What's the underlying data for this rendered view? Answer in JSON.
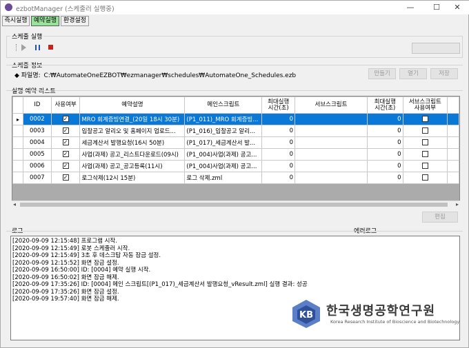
{
  "window": {
    "title": "ezbotManager (스케줄러 실행중)",
    "controls": {
      "minimize": "—",
      "maximize": "☐",
      "close": "✕"
    }
  },
  "tabs": [
    {
      "label": "즉시실행",
      "active": false
    },
    {
      "label": "예약실행",
      "active": true
    },
    {
      "label": "환경설정",
      "active": false
    }
  ],
  "scheduler_run": {
    "label": "스케줄 실행",
    "controls": [
      "play",
      "pause",
      "stop"
    ]
  },
  "schedule_info": {
    "label": "스케줄 정보",
    "file_prefix": "◆ 파일명:",
    "file_path": "C:₩AutomateOneEZBOT₩ezmanager₩schedules₩AutomateOne_Schedules.ezb",
    "buttons": {
      "new": "만들기",
      "open": "열기",
      "save": "저장"
    }
  },
  "schedule_list": {
    "label": "실행 예약 리스트",
    "columns": [
      "ID",
      "사용여부",
      "예약설명",
      "메인스크립트",
      "최대실행\n시간(초)",
      "서브스크립트",
      "최대실행\n시간(초)",
      "서브스크립트\n사용여부"
    ],
    "rows": [
      {
        "id": "0002",
        "enabled": true,
        "desc": "MRO 회계증빙연결_(20일 18시 30분)",
        "main": "(P1_011)_MRO 회계증빙...",
        "max1": "0",
        "sub": "",
        "max2": "0",
        "sub_enabled": false,
        "selected": true
      },
      {
        "id": "0003",
        "enabled": true,
        "desc": "입찰공고 알리오 및 홈페이지 업로드...",
        "main": "(P1_016)_입찰공고 알리...",
        "max1": "0",
        "sub": "",
        "max2": "0",
        "sub_enabled": false,
        "selected": false
      },
      {
        "id": "0004",
        "enabled": true,
        "desc": "세금계산서 발행요청(16시 50분)",
        "main": "(P1_017)_세금계산서 발...",
        "max1": "0",
        "sub": "",
        "max2": "0",
        "sub_enabled": false,
        "selected": false
      },
      {
        "id": "0005",
        "enabled": true,
        "desc": "사업(과제) 공고_리스트다운로드(09시)",
        "main": "(P1_004)사업(과제) 공고...",
        "max1": "0",
        "sub": "",
        "max2": "0",
        "sub_enabled": false,
        "selected": false
      },
      {
        "id": "0006",
        "enabled": true,
        "desc": "사업(과제) 공고_공고등록(11시)",
        "main": "(P1_004)사업(과제) 공고...",
        "max1": "0",
        "sub": "",
        "max2": "0",
        "sub_enabled": false,
        "selected": false
      },
      {
        "id": "0007",
        "enabled": true,
        "desc": "로그삭제(12시 15분)",
        "main": "로그 삭제.zml",
        "max1": "0",
        "sub": "",
        "max2": "0",
        "sub_enabled": false,
        "selected": false
      }
    ],
    "edit_button": "편집"
  },
  "log": {
    "label": "로그",
    "error_label": "에러로그",
    "lines": [
      "[2020-09-09 12:15:48] 프로그램 시작.",
      "[2020-09-09 12:15:49] 로봇 스케줄러 시작.",
      "[2020-09-09 12:15:49] 3초 후 데스크탑 자동 잠금 설정.",
      "[2020-09-09 12:15:52] 화면 잠금 설정.",
      "[2020-09-09 16:50:00] ID: [0004] 예약 실행 시작.",
      "[2020-09-09 16:50:02] 화면 잠금 해제.",
      "[2020-09-09 17:35:26] ID: [0004] 메인 스크립트[(P1_017)_세금계산서 발행요청_vResult.zml] 실행 결과: 성공",
      "[2020-09-09 17:35:26] 화면 잠금 설정.",
      "[2020-09-09 19:57:40] 화면 잠금 해제."
    ]
  },
  "watermark": {
    "korean": "한국생명공학연구원",
    "english": "Korea Research Institute of Bioscience and Biotechnology",
    "logo_text": "KB"
  },
  "colors": {
    "active_tab": "#98e29a",
    "selection": "#0a78d7",
    "pause_icon": "#1b4fc4",
    "stop_icon": "#c0261d"
  }
}
